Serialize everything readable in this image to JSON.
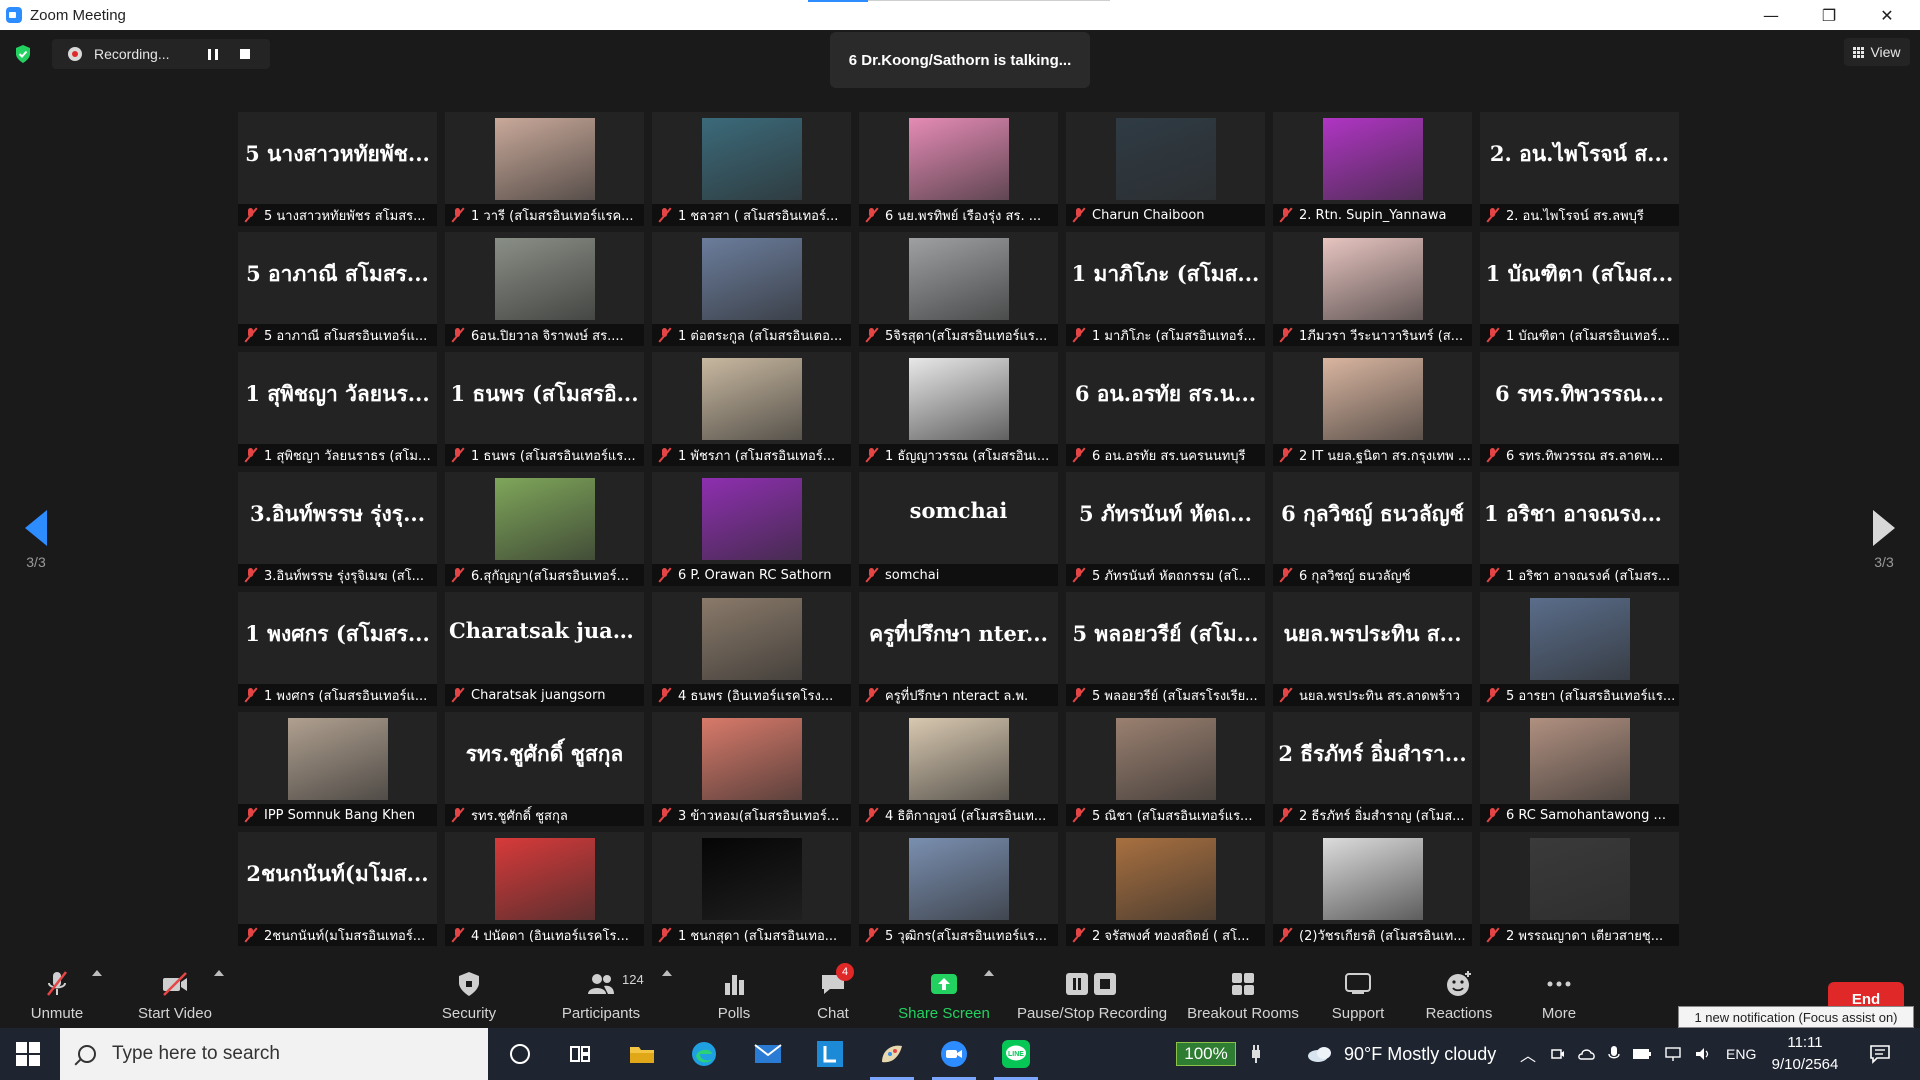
{
  "window": {
    "title": "Zoom Meeting",
    "minimize": "—",
    "restore": "❐",
    "close": "✕"
  },
  "meeting": {
    "recording_label": "Recording...",
    "talking_indicator": "6 Dr.Koong/Sathorn is talking...",
    "view_label": "View",
    "page_left": "3/3",
    "page_right": "3/3"
  },
  "tiles": [
    {
      "big": "5 นางสาวหทัยพัช...",
      "caption": "5 นางสาวหทัยพัชร สโมสร..."
    },
    {
      "photo": "#c9a99a",
      "caption": "1 วารี (สโมสรอินเทอร์แรค..."
    },
    {
      "photo": "#3b6a7a",
      "caption": "1 ชลวสา ( สโมสรอินเทอร์..."
    },
    {
      "photo": "#e58bb5",
      "caption": "6  นย.พรทิพย์ เรืองรุ่ง สร. ..."
    },
    {
      "photo": "#2f3b44",
      "caption": "Charun Chaiboon"
    },
    {
      "photo": "#b035c4",
      "caption": "2. Rtn. Supin_Yannawa"
    },
    {
      "big": "2. อน.ไพโรจน์ ส...",
      "caption": "2. อน.ไพโรจน์ สร.ลพบุรี"
    },
    {
      "big": "5 อาภาณี สโมสร...",
      "caption": "5 อาภาณี สโมสรอินเทอร์แ..."
    },
    {
      "photo": "#8a8f86",
      "caption": "6อน.ปิยวาล จิราพงษ์ สร...."
    },
    {
      "photo": "#6b7d9c",
      "caption": "1 ต่อตระกูล (สโมสรอินเตอ..."
    },
    {
      "photo": "#9ea0a2",
      "caption": "5จิรสุดา(สโมสรอินเทอร์แร..."
    },
    {
      "big": "1 มาภิโภะ (สโมส...",
      "caption": "1 มาภิโภะ (สโมสรอินเทอร์..."
    },
    {
      "photo": "#e7c4c0",
      "caption": "1ภีมวรา วีระนาวารินทร์ (ส..."
    },
    {
      "big": "1 บัณฑิตา (สโมส...",
      "caption": "1 บัณฑิตา (สโมสรอินเทอร์..."
    },
    {
      "big": "1 สุพิชญา วัลยนร...",
      "caption": "1 สุพิชญา วัลยนราธร (สโมสร..."
    },
    {
      "big": "1 ธนพร (สโมสรอิ...",
      "caption": "1 ธนพร (สโมสรอินเทอร์แร..."
    },
    {
      "photo": "#c8b8a0",
      "caption": "1 พัชรภา (สโมสรอินเทอร์..."
    },
    {
      "photo": "#e8e8e8",
      "caption": "1 ธัญญาวรรณ (สโมสรอินเ..."
    },
    {
      "big": "6 อน.อรทัย สร.น...",
      "caption": "6 อน.อรทัย  สร.นครนนทบุรี"
    },
    {
      "photo": "#d9b5a0",
      "caption": "2 IT นยล.ฐนิตา สร.กรุงเทพ น..."
    },
    {
      "big": "6 รทร.ทิพวรรณ...",
      "caption": "6 รทร.ทิพวรรณ สร.ลาดพ..."
    },
    {
      "big": "3.อินท์พรรษ รุ่งรุ...",
      "caption": "3.อินท์พรรษ รุ่งรุจิเมฆ (สโ..."
    },
    {
      "photo": "#7fa65a",
      "caption": "6.สุกัญญา(สโมสรอินเทอร์..."
    },
    {
      "photo": "#8e2fb0",
      "caption": "6 P. Orawan RC Sathorn"
    },
    {
      "big": "somchai",
      "caption": "somchai"
    },
    {
      "big": "5 ภัทรนันท์ หัตถ...",
      "caption": "5 ภัทรนันท์ หัตถกรรม (สโ..."
    },
    {
      "big": "6 กุลวิชญ์ ธนวลัญช์",
      "caption": "6 กุลวิชญ์ ธนวลัญช์"
    },
    {
      "big": "1 อริชา อาจณรงค์...",
      "caption": "1 อริชา อาจณรงค์ (สโมสร..."
    },
    {
      "big": "1 พงศกร (สโมสร...",
      "caption": "1 พงศกร (สโมสรอินเทอร์แ..."
    },
    {
      "big": "Charatsak  juang...",
      "caption": "Charatsak juangsorn"
    },
    {
      "photo": "#8a7a6a",
      "caption": "4 ธนพร (อินเทอร์แรคโรง..."
    },
    {
      "big": "ครูที่ปรึกษา nter...",
      "caption": "ครูที่ปรึกษา nteract ล.พ."
    },
    {
      "big": "5 พลอยวรีย์ (สโม...",
      "caption": "5 พลอยวรีย์ (สโมสรโรงเรีย..."
    },
    {
      "big": "นยล.พรประทิน ส...",
      "caption": "นยล.พรประทิน สร.ลาดพร้าว"
    },
    {
      "photo": "#5a6d8a",
      "caption": "5 อารยา (สโมสรอินเทอร์แร..."
    },
    {
      "photo": "#b0a090",
      "caption": "IPP Somnuk Bang Khen"
    },
    {
      "big": "รทร.ชูศักดิ์ ชูสกุล",
      "caption": "รทร.ชูศักดิ์ ชูสกุล"
    },
    {
      "photo": "#d87a6a",
      "caption": "3 ข้าวหอม(สโมสรอินเทอร์..."
    },
    {
      "photo": "#d8c8b0",
      "caption": "4 ธิติกาญจน์ (สโมสรอินเท..."
    },
    {
      "photo": "#9a8070",
      "caption": "5 ณิชา (สโมสรอินเทอร์แร..."
    },
    {
      "big": "2 ธีรภัทร์ อิ่มสำรา...",
      "caption": "2 ธีรภัทร์ อิ่มสำราญ (สโมส..."
    },
    {
      "photo": "#b09080",
      "caption": "6 RC Samohantawong ..."
    },
    {
      "big": "2ชนกนันท์(มโมส...",
      "caption": "2ชนกนันท์(มโมสรอินเทอร์..."
    },
    {
      "photo": "#d83a3a",
      "caption": "4 ปนัดดา (อินเทอร์แรคโร..."
    },
    {
      "photo": "#050505",
      "caption": "1 ชนกสุดา (สโมสรอินเทอ..."
    },
    {
      "photo": "#7a8fb0",
      "caption": "5 วุฒิกร(สโมสรอินเทอร์แร..."
    },
    {
      "photo": "#a87040",
      "caption": "2 จรัสพงศ์ ทองสถิตย์ ( สโ..."
    },
    {
      "photo": "#dcdcdc",
      "caption": "(2)วัชรเกียรติ (สโมสรอินเท..."
    },
    {
      "photo": "#3a3a3a",
      "caption": "2 พรรณญาดา เตียวสายชุ..."
    }
  ],
  "toolbar": {
    "unmute": "Unmute",
    "start_video": "Start Video",
    "security": "Security",
    "participants": "Participants",
    "participant_count": "124",
    "polls": "Polls",
    "chat": "Chat",
    "chat_badge": "4",
    "share_screen": "Share Screen",
    "pause_stop": "Pause/Stop Recording",
    "breakout": "Breakout Rooms",
    "support": "Support",
    "reactions": "Reactions",
    "more": "More",
    "end": "End",
    "notification": "1 new notification (Focus assist on)"
  },
  "taskbar": {
    "search_placeholder": "Type here to search",
    "battery": "100%",
    "weather": "90°F  Mostly cloudy",
    "lang": "ENG",
    "time": "11:11",
    "date": "9/10/2564"
  },
  "colors": {
    "accent": "#2d8cff",
    "muted_red": "#e64545",
    "share_green": "#23d160",
    "end_red": "#e02828"
  }
}
